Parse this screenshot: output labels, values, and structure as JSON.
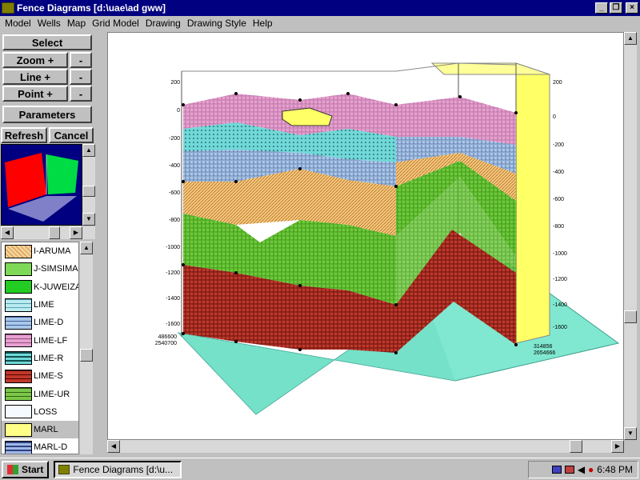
{
  "window": {
    "title": "Fence Diagrams [d:\\uae\\ad gww]"
  },
  "menu": [
    "Model",
    "Wells",
    "Map",
    "Grid Model",
    "Drawing",
    "Drawing Style",
    "Help"
  ],
  "left_panel": {
    "select": "Select",
    "zoom_plus": "Zoom +",
    "line_plus": "Line +",
    "point_plus": "Point +",
    "minus": "-",
    "parameters": "Parameters",
    "refresh": "Refresh",
    "cancel": "Cancel"
  },
  "legend": {
    "items": [
      {
        "label": "I-ARUMA",
        "color": "#f2d29a"
      },
      {
        "label": "J-SIMSIMA",
        "color": "#7ed957"
      },
      {
        "label": "K-JUWEIZA",
        "color": "#22cc22"
      },
      {
        "label": "LIME",
        "color": "#b8ecf0"
      },
      {
        "label": "LIME-D",
        "color": "#a8c8e8"
      },
      {
        "label": "LIME-LF",
        "color": "#e8a0d0"
      },
      {
        "label": "LIME-R",
        "color": "#70d8d8"
      },
      {
        "label": "LIME-S",
        "color": "#c0392b"
      },
      {
        "label": "LIME-UR",
        "color": "#7cc84a"
      },
      {
        "label": "LOSS",
        "color": "#f4faff"
      },
      {
        "label": "MARL",
        "color": "#ffff88"
      },
      {
        "label": "MARL-D",
        "color": "#9fb8e8"
      }
    ],
    "selected": "MARL"
  },
  "diagram": {
    "left_depth_labels": [
      "200",
      "0",
      "-200",
      "-400",
      "-600",
      "-800",
      "-1000",
      "-1200",
      "-1400",
      "-1600"
    ],
    "right_depth_labels": [
      "200",
      "0",
      "-200",
      "-400",
      "-600",
      "-800",
      "-1000",
      "-1200",
      "-1400",
      "-1600"
    ],
    "corner_left": [
      "486600",
      "2540700"
    ],
    "corner_right": [
      "314856",
      "2654666"
    ]
  },
  "taskbar": {
    "start": "Start",
    "task": "Fence Diagrams [d:\\u...",
    "clock": "6:48 PM"
  }
}
